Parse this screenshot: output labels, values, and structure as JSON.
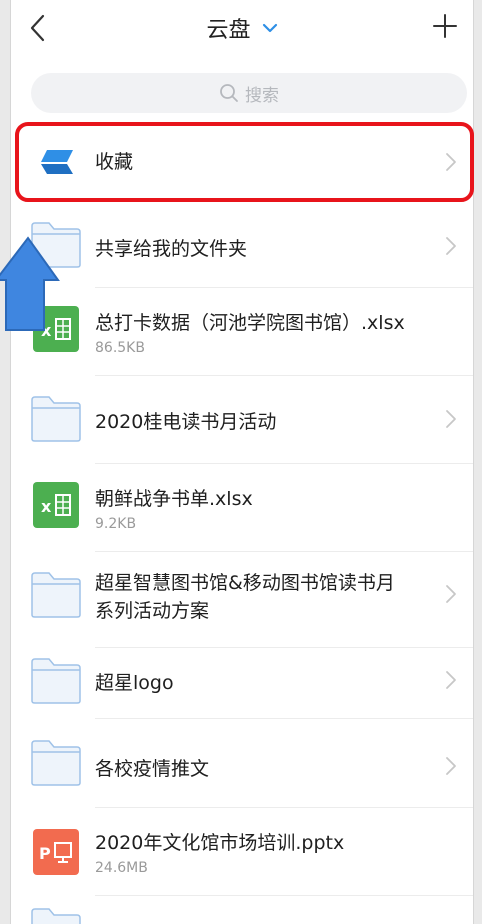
{
  "header": {
    "title": "云盘"
  },
  "search": {
    "placeholder": "搜索"
  },
  "favorites": {
    "label": "收藏"
  },
  "items": [
    {
      "type": "folder",
      "name": "共享给我的文件夹"
    },
    {
      "type": "xlsx",
      "name": "总打卡数据（河池学院图书馆）.xlsx",
      "size": "86.5KB"
    },
    {
      "type": "folder",
      "name": "2020桂电读书月活动"
    },
    {
      "type": "xlsx",
      "name": "朝鲜战争书单.xlsx",
      "size": "9.2KB"
    },
    {
      "type": "folder",
      "name_line1": "超星智慧图书馆&移动图书馆读书月",
      "name_line2": "系列活动方案"
    },
    {
      "type": "folder",
      "name": "超星logo"
    },
    {
      "type": "folder",
      "name": "各校疫情推文"
    },
    {
      "type": "pptx",
      "name": "2020年文化馆市场培训.pptx",
      "size": "24.6MB"
    }
  ],
  "colors": {
    "accent_blue": "#2f8fe6",
    "folder_fill": "#eef4fb",
    "folder_stroke": "#9fc2e8",
    "excel_green": "#4caf50",
    "ppt_orange": "#f26b4f",
    "highlight_red": "#e8141b",
    "callout_blue": "#3f86e0"
  },
  "icons": {
    "back": "chevron-left-icon",
    "title_dropdown": "chevron-down-icon",
    "add": "plus-icon",
    "search": "search-icon",
    "favorites": "favorites-stack-icon",
    "folder": "folder-icon",
    "excel": "excel-file-icon",
    "ppt": "ppt-file-icon",
    "row_arrow": "chevron-right-icon"
  }
}
